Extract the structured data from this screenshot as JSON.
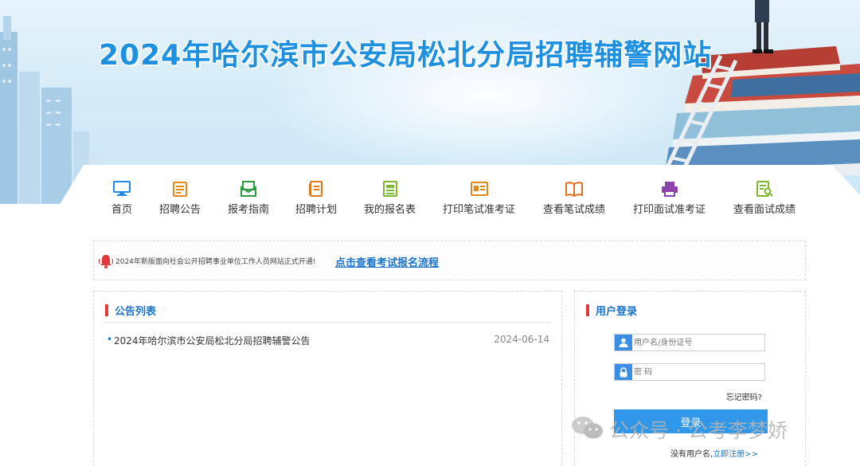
{
  "header": {
    "title": "2024年哈尔滨市公安局松北分局招聘辅警网站"
  },
  "nav": {
    "items": [
      {
        "label": "首页",
        "icon": "monitor-icon"
      },
      {
        "label": "招聘公告",
        "icon": "notice-board-icon"
      },
      {
        "label": "报考指南",
        "icon": "mail-guide-icon"
      },
      {
        "label": "招聘计划",
        "icon": "document-plan-icon"
      },
      {
        "label": "我的报名表",
        "icon": "form-icon"
      },
      {
        "label": "打印笔试准考证",
        "icon": "id-card-icon"
      },
      {
        "label": "查看笔试成绩",
        "icon": "open-book-icon"
      },
      {
        "label": "打印面试准考证",
        "icon": "printer-icon"
      },
      {
        "label": "查看面试成绩",
        "icon": "search-document-icon"
      }
    ],
    "colors": [
      "#1e88e5",
      "#e68a19",
      "#2e9e44",
      "#e07a1e",
      "#7cb82f",
      "#e08a1e",
      "#e0701e",
      "#8e44ad",
      "#7cb82f"
    ]
  },
  "notice": {
    "marquee": "2024年新版面向社会公开招聘事业单位工作人员网站正式开通!",
    "flow_link": "点击查看考试报名流程",
    "bell_icon": "bell-icon"
  },
  "announcements": {
    "title": "公告列表",
    "items": [
      {
        "title": "2024年哈尔滨市公安局松北分局招聘辅警公告",
        "date": "2024-06-14"
      }
    ]
  },
  "login": {
    "title": "用户登录",
    "username_placeholder": "用户名/身份证号",
    "password_placeholder": "密 码",
    "forgot": "忘记密码?",
    "button": "登录",
    "no_account": "没有用户名,",
    "register": "立即注册>>"
  },
  "watermark": {
    "text": "公众号 · 公考李梦娇"
  },
  "colors": {
    "title_blue": "#1e90e0",
    "link_blue": "#1a73c9",
    "accent_red": "#e03a3a",
    "button_blue": "#3197e8"
  }
}
